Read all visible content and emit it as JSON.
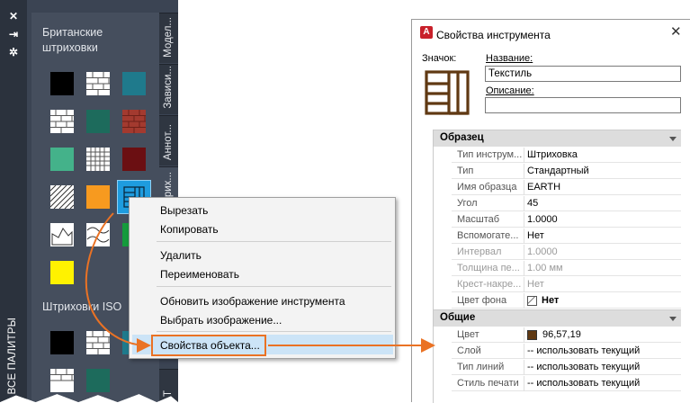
{
  "palette": {
    "strip_buttons": [
      "✕",
      "⇥",
      "✲"
    ],
    "strip_title": "ВСЕ ПАЛИТРЫ",
    "group1_title": "Британские штриховки",
    "group2_title": "Штриховки ISO",
    "tabs": [
      "Модел...",
      "Зависи...",
      "Аннот...",
      "Штрих...",
      "Т"
    ]
  },
  "context_menu": {
    "items": [
      {
        "label": "Вырезать"
      },
      {
        "label": "Копировать"
      },
      {
        "label": "Удалить"
      },
      {
        "label": "Переименовать"
      },
      {
        "label": "Обновить изображение инструмента"
      },
      {
        "label": "Выбрать изображение..."
      },
      {
        "label": "Свойства объекта..."
      }
    ],
    "highlighted": "Свойства объекта..."
  },
  "dialog": {
    "title": "Свойства инструмента",
    "close_glyph": "✕",
    "icon_label": "Значок:",
    "name_label": "Название:",
    "name_value": "Текстиль",
    "description_label": "Описание:",
    "description_value": "",
    "sections": [
      {
        "title": "Образец",
        "rows": [
          {
            "key": "Тип инструм...",
            "value": "Штриховка"
          },
          {
            "key": "Тип",
            "value": "Стандартный"
          },
          {
            "key": "Имя образца",
            "value": "EARTH"
          },
          {
            "key": "Угол",
            "value": "45"
          },
          {
            "key": "Масштаб",
            "value": "1.0000"
          },
          {
            "key": "Вспомогате...",
            "value": "Нет"
          },
          {
            "key": "Интервал",
            "value": "1.0000"
          },
          {
            "key": "Толщина пе...",
            "value": "1.00 мм"
          },
          {
            "key": "Крест-накре...",
            "value": "Нет"
          },
          {
            "key": "Цвет фона",
            "value": "Нет"
          }
        ]
      },
      {
        "title": "Общие",
        "rows": [
          {
            "key": "Цвет",
            "value": "96,57,19"
          },
          {
            "key": "Слой",
            "value": "-- использовать текущий"
          },
          {
            "key": "Тип линий",
            "value": "-- использовать текущий"
          },
          {
            "key": "Стиль печати",
            "value": "-- использовать текущий"
          }
        ]
      }
    ]
  },
  "colors": {
    "accent_orange": "#ea7224",
    "highlight_blue": "#cce4f7",
    "selected_tool_blue": "#1e9cdf",
    "earth_brown": "#603913"
  }
}
